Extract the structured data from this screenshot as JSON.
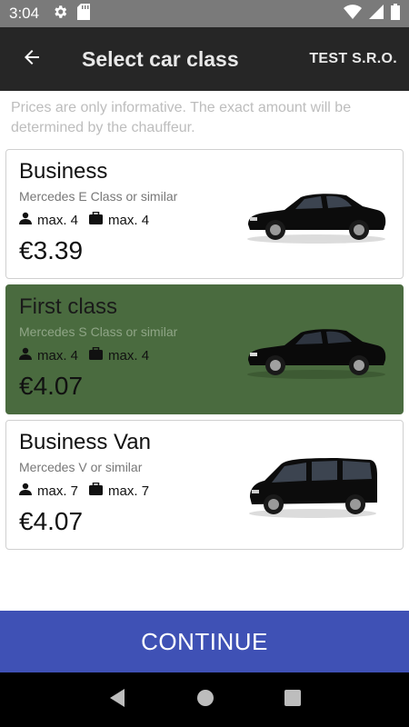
{
  "status_bar": {
    "time": "3:04",
    "icons": [
      "gear-icon",
      "sd-card-icon",
      "wifi-icon",
      "signal-icon",
      "battery-icon"
    ]
  },
  "app_bar": {
    "title": "Select car class",
    "company": "TEST S.R.O.",
    "back_icon": "arrow-back-icon"
  },
  "notice": "Prices are only informative. The exact amount will be determined by the chauffeur.",
  "car_classes": [
    {
      "name": "Business",
      "model": "Mercedes E Class or similar",
      "passengers": "max. 4",
      "luggage": "max. 4",
      "price": "€3.39",
      "selected": false,
      "image": "sedan-car-image"
    },
    {
      "name": "First class",
      "model": "Mercedes S Class or similar",
      "passengers": "max. 4",
      "luggage": "max. 4",
      "price": "€4.07",
      "selected": true,
      "image": "luxury-sedan-car-image"
    },
    {
      "name": "Business Van",
      "model": "Mercedes V or similar",
      "passengers": "max. 7",
      "luggage": "max. 7",
      "price": "€4.07",
      "selected": false,
      "image": "van-car-image"
    }
  ],
  "continue_label": "CONTINUE",
  "colors": {
    "app_bar": "#262626",
    "selected_card": "#4a6b3f",
    "continue_button": "#3f51b5",
    "status_bar": "#7a7a7a"
  }
}
